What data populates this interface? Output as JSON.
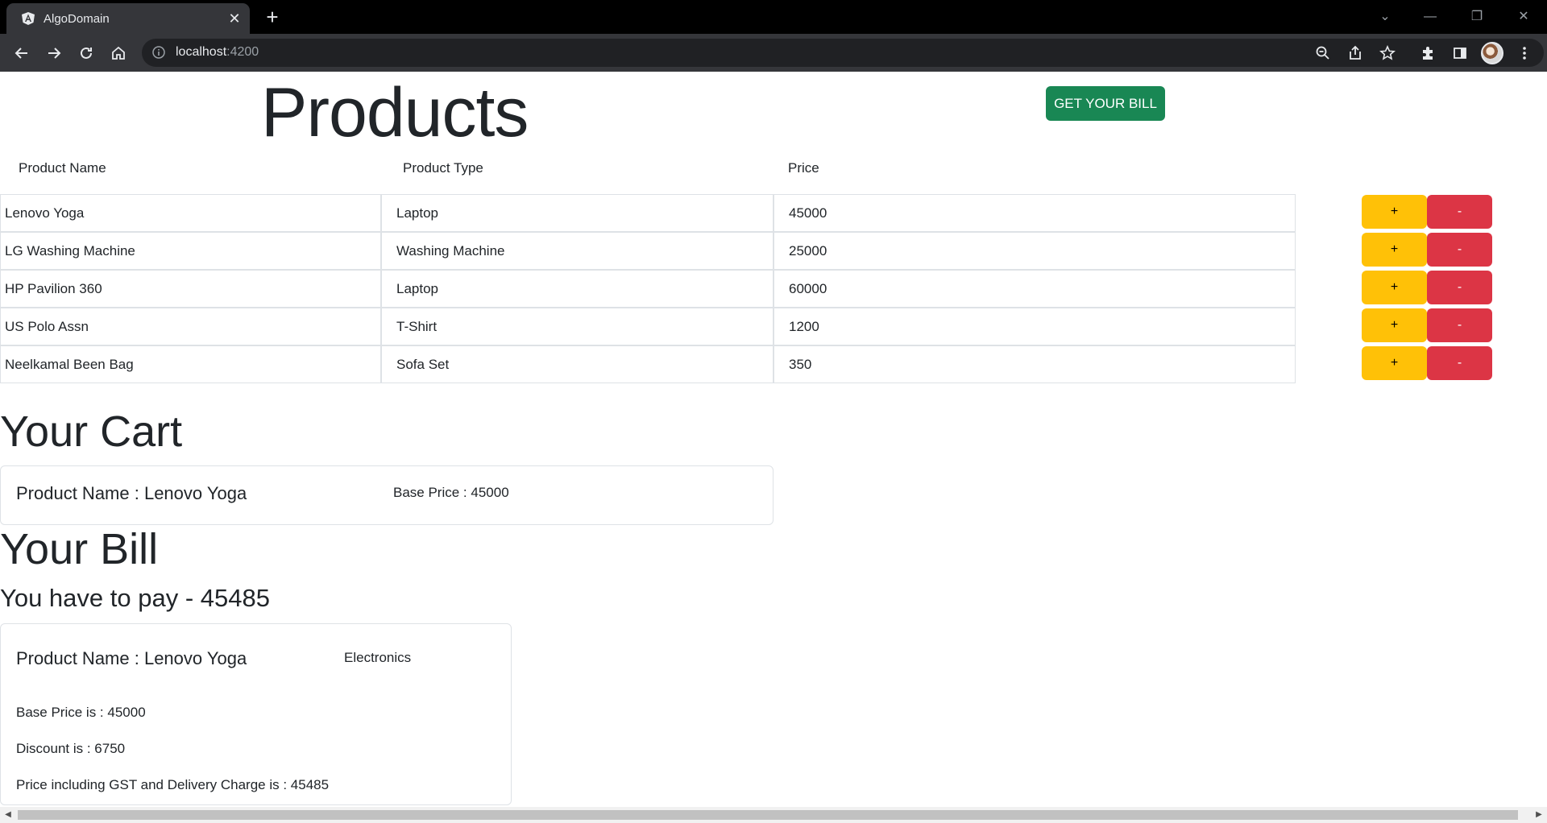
{
  "browser": {
    "tab_title": "AlgoDomain",
    "url_host": "localhost",
    "url_port": ":4200",
    "icons": [
      "angular-icon",
      "close-icon",
      "new-tab-icon",
      "back-icon",
      "forward-icon",
      "reload-icon",
      "home-icon",
      "info-icon",
      "zoom-icon",
      "share-icon",
      "bookmark-star-icon",
      "extensions-icon",
      "side-panel-icon",
      "profile-avatar",
      "kebab-menu-icon"
    ]
  },
  "products": {
    "title": "Products",
    "bill_button": "GET YOUR BILL",
    "columns": [
      "Product Name",
      "Product Type",
      "Price"
    ],
    "rows": [
      {
        "name": "Lenovo Yoga",
        "type": "Laptop",
        "price": "45000"
      },
      {
        "name": "LG Washing Machine",
        "type": "Washing Machine",
        "price": "25000"
      },
      {
        "name": "HP Pavilion 360",
        "type": "Laptop",
        "price": "60000"
      },
      {
        "name": "US Polo Assn",
        "type": "T-Shirt",
        "price": "1200"
      },
      {
        "name": "Neelkamal Been Bag",
        "type": "Sofa Set",
        "price": "350"
      }
    ],
    "plus_label": "+",
    "minus_label": "-"
  },
  "cart": {
    "title": "Your Cart",
    "item_name": "Product Name : Lenovo Yoga",
    "item_price": "Base Price : 45000"
  },
  "bill": {
    "title": "Your Bill",
    "pay_line": "You have to pay - 45485",
    "item_name": "Product Name : Lenovo Yoga",
    "category": "Electronics",
    "base_price": "Base Price is : 45000",
    "discount": "Discount is : 6750",
    "final_price": "Price including GST and Delivery Charge is : 45485"
  },
  "colors": {
    "success": "#198754",
    "warning": "#ffc107",
    "danger": "#dc3545"
  }
}
